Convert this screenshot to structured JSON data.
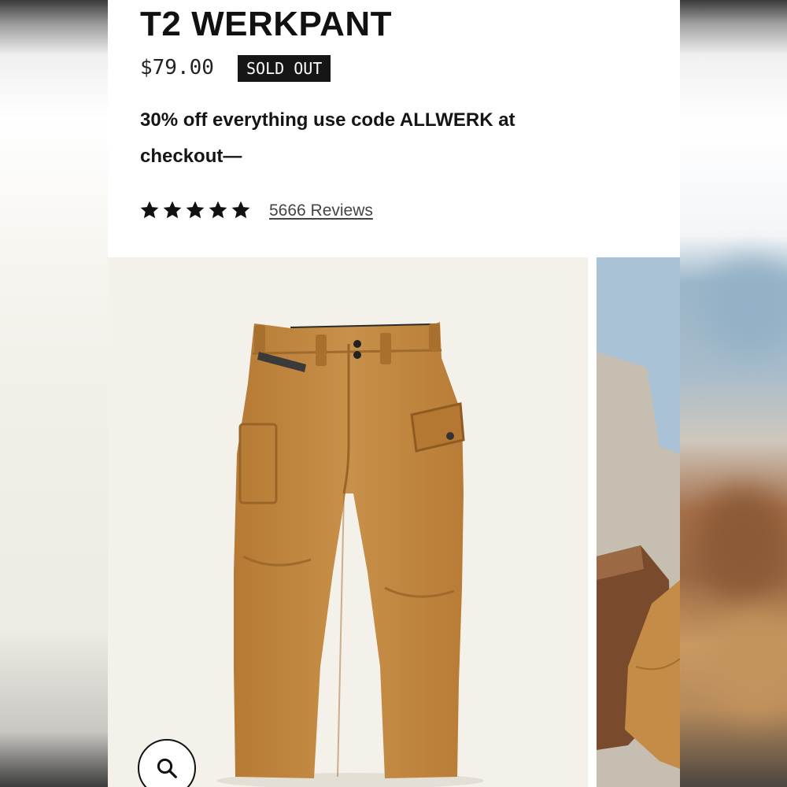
{
  "product": {
    "title": "T2 WERKPANT",
    "price": "$79.00",
    "badge": "SOLD OUT",
    "promo": "30% off everything use code ALLWERK at checkout—",
    "rating": 5,
    "reviews_label": "5666 Reviews"
  },
  "gallery": {
    "main_image": "tan-work-pants-product-photo",
    "next_image": "pants-and-boot-lifestyle-photo",
    "zoom_icon": "magnifier-icon"
  },
  "colors": {
    "badge_bg": "#161616",
    "pant_tan": "#c1883f",
    "image_bg": "#f4f1ea"
  }
}
